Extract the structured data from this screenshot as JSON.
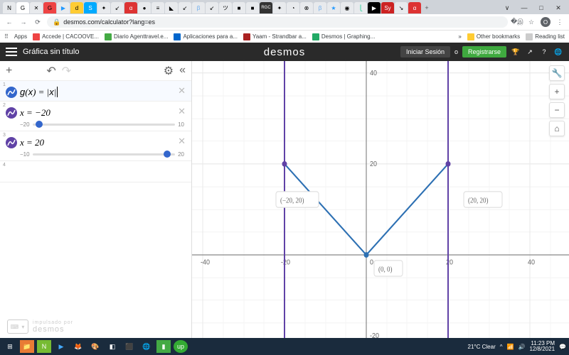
{
  "browser": {
    "url": "desmos.com/calculator?lang=es",
    "bookmarks_label": "Apps",
    "bookmarks": [
      {
        "label": "Accede | CACOOVE..."
      },
      {
        "label": "Diario Agenttravel.e..."
      },
      {
        "label": "Aplicaciones para a..."
      },
      {
        "label": "Yaam - Strandbar a..."
      },
      {
        "label": "Desmos | Graphing..."
      }
    ],
    "other_bookmarks": "Other bookmarks",
    "reading_list": "Reading list"
  },
  "header": {
    "title": "Gráfica sin título",
    "logo": "desmos",
    "login": "Iniciar Sesión",
    "or": "o",
    "signup": "Registrarse"
  },
  "expressions": [
    {
      "idx": "1",
      "formula": "g(x) = |x|",
      "type": "function"
    },
    {
      "idx": "2",
      "formula": "x = −20",
      "type": "slider",
      "min": "−20",
      "max": "10",
      "thumb_pct": 5
    },
    {
      "idx": "3",
      "formula": "x = 20",
      "type": "slider",
      "min": "−10",
      "max": "20",
      "thumb_pct": 95
    },
    {
      "idx": "4",
      "formula": "",
      "type": "empty"
    }
  ],
  "footer": {
    "powered_top": "impulsado por",
    "powered": "desmos"
  },
  "chart_data": {
    "type": "line",
    "title": "",
    "xlabel": "",
    "ylabel": "",
    "xlim": [
      -40,
      40
    ],
    "ylim": [
      -20,
      40
    ],
    "xticks": [
      -40,
      -20,
      0,
      20,
      40
    ],
    "yticks": [
      -20,
      20,
      40
    ],
    "series": [
      {
        "name": "g(x)=|x|",
        "x": [
          -20,
          0,
          20
        ],
        "y": [
          20,
          0,
          20
        ],
        "color": "#2d70b3"
      },
      {
        "name": "x=-20",
        "vline": -20,
        "color": "#6042a6"
      },
      {
        "name": "x=20",
        "vline": 20,
        "color": "#6042a6"
      }
    ],
    "annotations": [
      {
        "x": -20,
        "y": 20,
        "text": "(−20, 20)"
      },
      {
        "x": 0,
        "y": 0,
        "text": "(0, 0)"
      },
      {
        "x": 20,
        "y": 20,
        "text": "(20, 20)"
      }
    ]
  },
  "system": {
    "weather": "21°C  Clear",
    "time": "11:23 PM",
    "date": "12/8/2021"
  }
}
